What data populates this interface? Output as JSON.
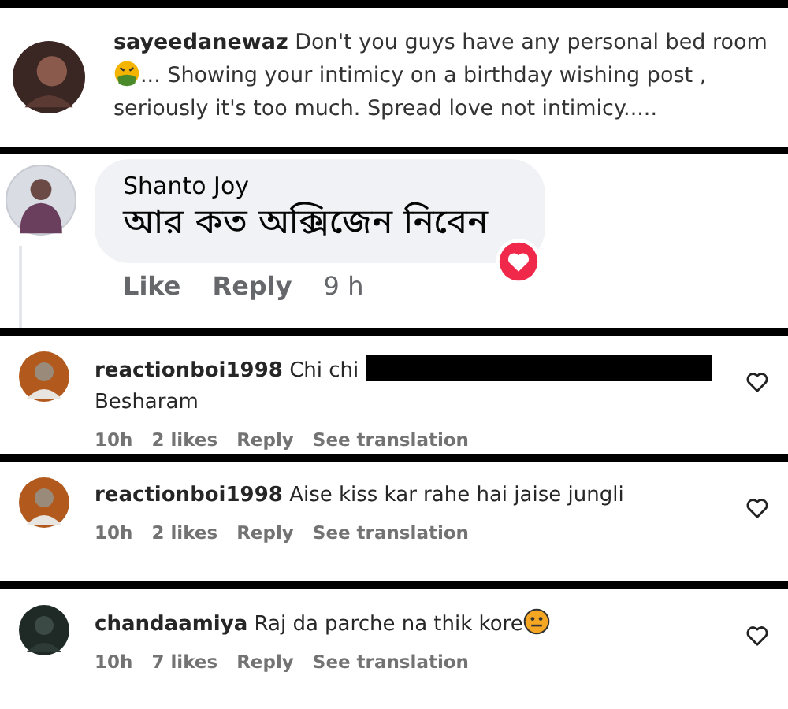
{
  "comments": [
    {
      "kind": "caption",
      "user": "sayeedanewaz",
      "segments": [
        {
          "kind": "text",
          "text": "Don't you guys have any personal bed room "
        },
        {
          "kind": "sick"
        },
        {
          "kind": "text",
          "text": "... Showing your intimicy on a birthday wishing post , seriously it's too much. Spread love not intimicy....."
        }
      ]
    },
    {
      "kind": "bubble",
      "user": "Shanto Joy",
      "body": "আর কত অক্সিজেন নিবেন",
      "actions": [
        "Like",
        "Reply"
      ],
      "time": "9 h",
      "reacted": true
    },
    {
      "kind": "comment",
      "user": "reactionboi1998",
      "segments": [
        {
          "kind": "text",
          "text": "Chi chi "
        },
        {
          "kind": "redacted"
        },
        {
          "kind": "text",
          "text": " Besharam"
        }
      ],
      "time": "10h",
      "likes": "2 likes",
      "actions": [
        "Reply",
        "See translation"
      ]
    },
    {
      "kind": "comment",
      "user": "reactionboi1998",
      "segments": [
        {
          "kind": "text",
          "text": "Aise kiss kar rahe hai jaise jungli"
        }
      ],
      "time": "10h",
      "likes": "2 likes",
      "actions": [
        "Reply",
        "See translation"
      ]
    },
    {
      "kind": "comment",
      "user": "chandaamiya",
      "segments": [
        {
          "kind": "text",
          "text": "Raj da parche na thik kore"
        },
        {
          "kind": "neutral"
        }
      ],
      "time": "10h",
      "likes": "7 likes",
      "actions": [
        "Reply",
        "See translation"
      ]
    }
  ]
}
